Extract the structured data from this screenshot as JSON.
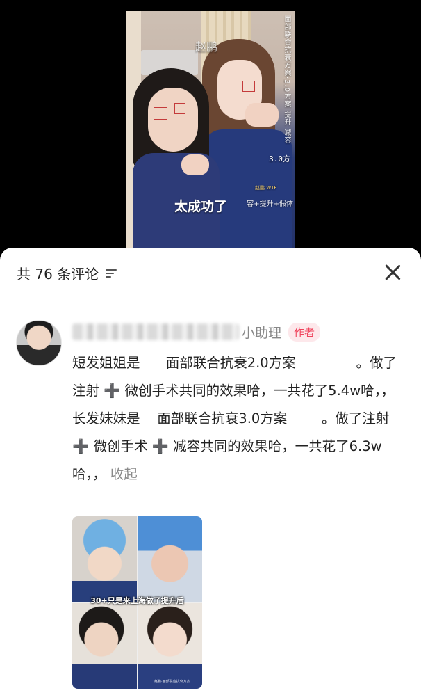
{
  "video": {
    "watermark": "赵鹏",
    "side_text": "面部联合抗衰方案·3.0方案 提升 减容",
    "tag": "3.0方",
    "caption": "太成功了",
    "small_line": "容+提升+假体",
    "tiny_label": "赵鹏 WTF"
  },
  "comments": {
    "title": "共 76 条评论",
    "filter_icon": "filter-icon",
    "close_icon": "close-icon"
  },
  "comment": {
    "username_suffix": "小助理",
    "author_badge": "作者",
    "text": "短发姐姐是      面部联合抗衰2.0方案              。做了注射 ➕ 微创手术共同的效果哈，一共花了5.4w哈，，\n长发妹妹是    面部联合抗衰3.0方案        。做了注射 ➕ 微创手术 ➕ 减容共同的效果哈，一共花了6.3w哈，，",
    "collapse_label": "收起",
    "photo_caption": "30+只是来上海做了提升后",
    "photo_small_text": "赵鹏·面部联合抗衰方案"
  }
}
